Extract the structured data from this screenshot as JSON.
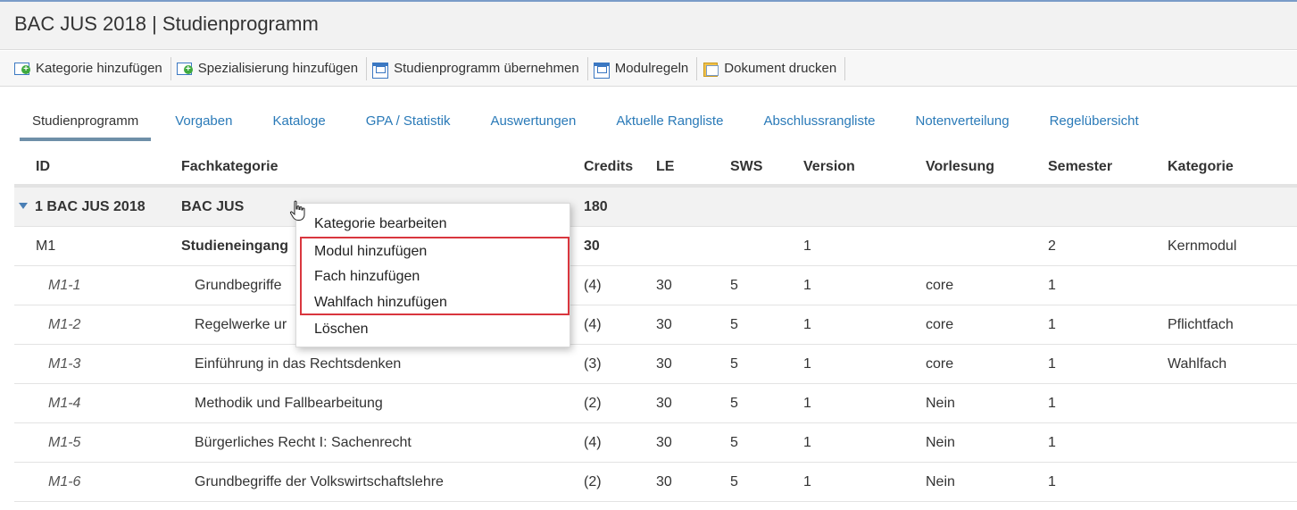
{
  "title": "BAC JUS 2018 | Studienprogramm",
  "toolbar": {
    "buttons": [
      {
        "label": "Kategorie hinzufügen",
        "icon": "add-category-icon"
      },
      {
        "label": "Spezialisierung hinzufügen",
        "icon": "add-specialization-icon"
      },
      {
        "label": "Studienprogramm übernehmen",
        "icon": "window-icon"
      },
      {
        "label": "Modulregeln",
        "icon": "window-icon"
      },
      {
        "label": "Dokument drucken",
        "icon": "print-icon"
      }
    ]
  },
  "tabs": [
    {
      "label": "Studienprogramm",
      "active": true
    },
    {
      "label": "Vorgaben"
    },
    {
      "label": "Kataloge"
    },
    {
      "label": "GPA / Statistik"
    },
    {
      "label": "Auswertungen"
    },
    {
      "label": "Aktuelle Rangliste"
    },
    {
      "label": "Abschlussrangliste"
    },
    {
      "label": "Notenverteilung"
    },
    {
      "label": "Regelübersicht"
    }
  ],
  "grid": {
    "columns": [
      "ID",
      "Fachkategorie",
      "Credits",
      "LE",
      "SWS",
      "Version",
      "Vorlesung",
      "Semester",
      "Kategorie"
    ],
    "rows": [
      {
        "id": "1 BAC JUS 2018",
        "fachkategorie": "BAC JUS",
        "credits": "180",
        "le": "",
        "sws": "",
        "version": "",
        "vorlesung": "",
        "semester": "",
        "kategorie": ""
      },
      {
        "id": "M1",
        "fachkategorie": "Studieneingang",
        "credits": "30",
        "le": "",
        "sws": "",
        "version": "1",
        "vorlesung": "",
        "semester": "2",
        "kategorie": "Kernmodul"
      },
      {
        "id": "M1-1",
        "fachkategorie": "Grundbegriffe",
        "credits": "(4)",
        "le": "30",
        "sws": "5",
        "version": "1",
        "vorlesung": "core",
        "semester": "1",
        "kategorie": ""
      },
      {
        "id": "M1-2",
        "fachkategorie": "Regelwerke ur",
        "credits": "(4)",
        "le": "30",
        "sws": "5",
        "version": "1",
        "vorlesung": "core",
        "semester": "1",
        "kategorie": "Pflichtfach"
      },
      {
        "id": "M1-3",
        "fachkategorie": "Einführung in das Rechtsdenken",
        "credits": "(3)",
        "le": "30",
        "sws": "5",
        "version": "1",
        "vorlesung": "core",
        "semester": "1",
        "kategorie": "Wahlfach"
      },
      {
        "id": "M1-4",
        "fachkategorie": "Methodik und Fallbearbeitung",
        "credits": "(2)",
        "le": "30",
        "sws": "5",
        "version": "1",
        "vorlesung": "Nein",
        "semester": "1",
        "kategorie": ""
      },
      {
        "id": "M1-5",
        "fachkategorie": "Bürgerliches Recht I: Sachenrecht",
        "credits": "(4)",
        "le": "30",
        "sws": "5",
        "version": "1",
        "vorlesung": "Nein",
        "semester": "1",
        "kategorie": ""
      },
      {
        "id": "M1-6",
        "fachkategorie": "Grundbegriffe der Volkswirtschaftslehre",
        "credits": "(2)",
        "le": "30",
        "sws": "5",
        "version": "1",
        "vorlesung": "Nein",
        "semester": "1",
        "kategorie": ""
      }
    ]
  },
  "context_menu": {
    "items": [
      "Kategorie bearbeiten",
      "Modul hinzufügen",
      "Fach hinzufügen",
      "Wahlfach hinzufügen",
      "Löschen"
    ],
    "highlight_color": "#d9363e"
  }
}
